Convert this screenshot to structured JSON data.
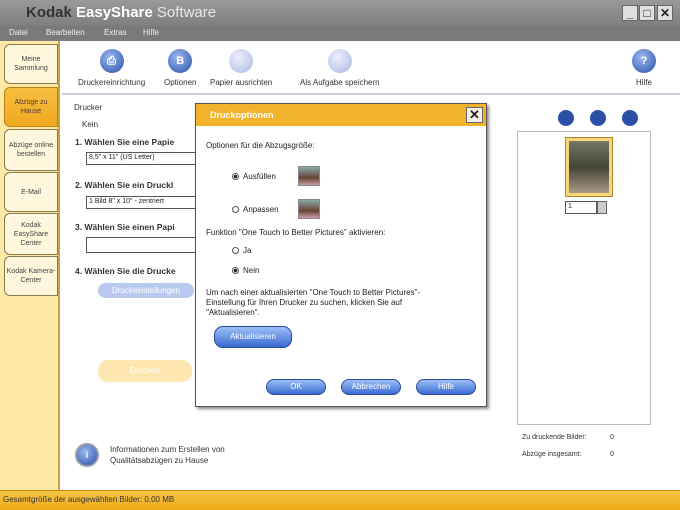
{
  "window": {
    "brand": "Kodak",
    "app": "EasyShare",
    "suffix": "Software",
    "controls": [
      "_",
      "□",
      "✕"
    ]
  },
  "menu": [
    "Datei",
    "Bearbeiten",
    "Extras",
    "Hilfe"
  ],
  "sidebar": [
    {
      "label": "Meine Sammlung",
      "active": false
    },
    {
      "label": "Abzüge zu Hause",
      "active": true
    },
    {
      "label": "Abzüge online bestellen",
      "active": false
    },
    {
      "label": "E-Mail",
      "active": false
    },
    {
      "label": "Kodak EasyShare Center",
      "active": false
    },
    {
      "label": "Kodak Kamera-Center",
      "active": false
    }
  ],
  "toolbar": [
    {
      "label": "Druckereinrichtung",
      "icon": "printer-setup-icon"
    },
    {
      "label": "Optionen",
      "icon": "options-icon"
    },
    {
      "label": "Papier ausrichten",
      "icon": "paper-align-icon"
    },
    {
      "label": "Als Aufgabe speichern",
      "icon": "save-task-icon"
    },
    {
      "label": "Hilfe",
      "icon": "help-icon"
    }
  ],
  "main": {
    "printer_label": "Drucker",
    "printer_value": "Kein",
    "step1": "1. Wählen Sie eine Papie",
    "step1_value": "8,5\" x 11\" (US Letter)",
    "step2": "2. Wählen Sie ein Druckl",
    "step2_value": "1 Bild 8\" x 10\" - zentriert",
    "step3": "3. Wählen Sie einen Papi",
    "step3_value": "",
    "step4": "4. Wählen Sie die Drucke",
    "step4_button": "Druckeinstellungen",
    "print_button": "Drucken"
  },
  "dialog": {
    "title": "Druckoptionen",
    "size_heading": "Optionen für die Abzugsgröße:",
    "fill": "Ausfüllen",
    "fit": "Anpassen",
    "size_selected": "Ausfüllen",
    "otb_heading": "Funktion \"One Touch to Better Pictures\" aktivieren:",
    "yes": "Ja",
    "no": "Nein",
    "otb_selected": "Nein",
    "update_text": "Um nach einer aktualisierten \"One Touch to Better Pictures\"-Einstellung für Ihren Drucker zu suchen, klicken Sie auf \"Aktualisieren\".",
    "update_button": "Aktualisieren",
    "ok": "OK",
    "cancel": "Abbrechen",
    "help": "Hilfe"
  },
  "preview": {
    "copies": "1"
  },
  "info": {
    "line1": "Informationen zum Erstellen von",
    "line2": "Qualitätsabzügen zu Hause"
  },
  "stats": [
    {
      "label": "Zu druckende Bilder:",
      "value": "0"
    },
    {
      "label": "Abzüge insgesamt:",
      "value": "0"
    }
  ],
  "status": "Gesamtgröße der ausgewählten Bilder: 0,00 MB"
}
